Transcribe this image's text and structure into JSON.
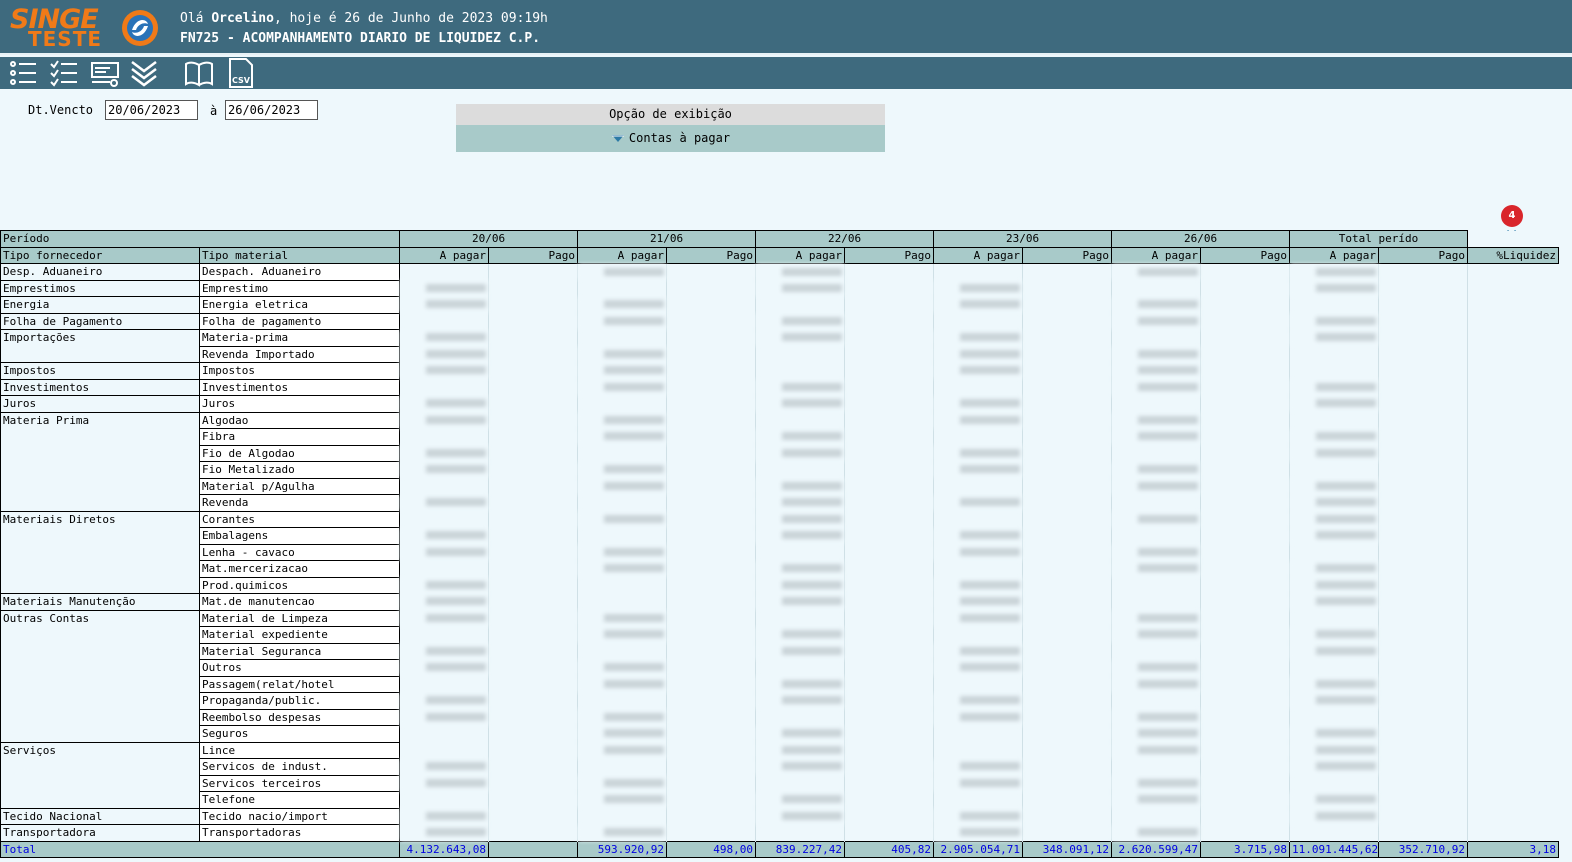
{
  "header": {
    "logo_line1": "SINGE",
    "logo_line2": "TESTE",
    "greeting_prefix": "Olá ",
    "user": "Orcelino",
    "greeting_suffix": ", hoje é 26 de Junho de 2023 09:19h",
    "screen_title": "FN725 - ACOMPANHAMENTO DIARIO DE LIQUIDEZ C.P."
  },
  "toolbar": {
    "icons": [
      "list-icon",
      "checklist-icon",
      "report-icon",
      "collapse-all-icon",
      "book-icon",
      "csv-export-icon"
    ],
    "csv_label": "CSV"
  },
  "filter": {
    "label": "Dt.Vencto",
    "date_from": "20/06/2023",
    "separator": "à",
    "date_to": "26/06/2023"
  },
  "display_option": {
    "title": "Opção de exibição",
    "selected": "Contas à pagar"
  },
  "notification_count": "4",
  "table": {
    "period_label": "Período",
    "supplier_type_label": "Tipo fornecedor",
    "material_type_label": "Tipo material",
    "periods": [
      "20/06",
      "21/06",
      "22/06",
      "23/06",
      "26/06",
      "Total perído"
    ],
    "a_pagar": "A pagar",
    "pago": "Pago",
    "liquidez": "%Liquidez",
    "groups": [
      {
        "supplier": "Desp. Aduaneiro",
        "materials": [
          "Despach. Aduaneiro"
        ]
      },
      {
        "supplier": "Emprestimos",
        "materials": [
          "Emprestimo"
        ]
      },
      {
        "supplier": "Energia",
        "materials": [
          "Energia eletrica"
        ]
      },
      {
        "supplier": "Folha de Pagamento",
        "materials": [
          "Folha de pagamento"
        ]
      },
      {
        "supplier": "Importações",
        "materials": [
          "Materia-prima",
          "Revenda Importado"
        ]
      },
      {
        "supplier": "Impostos",
        "materials": [
          "Impostos"
        ]
      },
      {
        "supplier": "Investimentos",
        "materials": [
          "Investimentos"
        ]
      },
      {
        "supplier": "Juros",
        "materials": [
          "Juros"
        ]
      },
      {
        "supplier": "Materia Prima",
        "materials": [
          "Algodao",
          "Fibra",
          "Fio de Algodao",
          "Fio Metalizado",
          "Material p/Agulha",
          "Revenda"
        ]
      },
      {
        "supplier": "Materiais Diretos",
        "materials": [
          "Corantes",
          "Embalagens",
          "Lenha - cavaco",
          "Mat.mercerizacao",
          "Prod.quimicos"
        ]
      },
      {
        "supplier": "Materiais Manutenção",
        "materials": [
          "Mat.de manutencao"
        ]
      },
      {
        "supplier": "Outras Contas",
        "materials": [
          "Material de Limpeza",
          "Material expediente",
          "Material Seguranca",
          "Outros",
          "Passagem(relat/hotel",
          "Propaganda/public.",
          "Reembolso despesas",
          "Seguros"
        ]
      },
      {
        "supplier": "Serviços",
        "materials": [
          "Lince",
          "Servicos de indust.",
          "Servicos terceiros",
          "Telefone"
        ]
      },
      {
        "supplier": "Tecido Nacional",
        "materials": [
          "Tecido nacio/import"
        ]
      },
      {
        "supplier": "Transportadora",
        "materials": [
          "Transportadoras"
        ]
      }
    ],
    "total": {
      "label": "Total",
      "values": [
        "4.132.643,08",
        "",
        "593.920,92",
        "498,00",
        "839.227,42",
        "405,82",
        "2.905.054,71",
        "348.091,12",
        "2.620.599,47",
        "3.715,98",
        "11.091.445,62",
        "352.710,92",
        "3,18"
      ]
    }
  },
  "colors": {
    "header_bg": "#3e6a7e",
    "accent": "#a8cac9",
    "logo_orange": "#f07a18",
    "total_text": "#0000e0",
    "badge": "#d9262b",
    "page_bg": "#eef8fc"
  }
}
